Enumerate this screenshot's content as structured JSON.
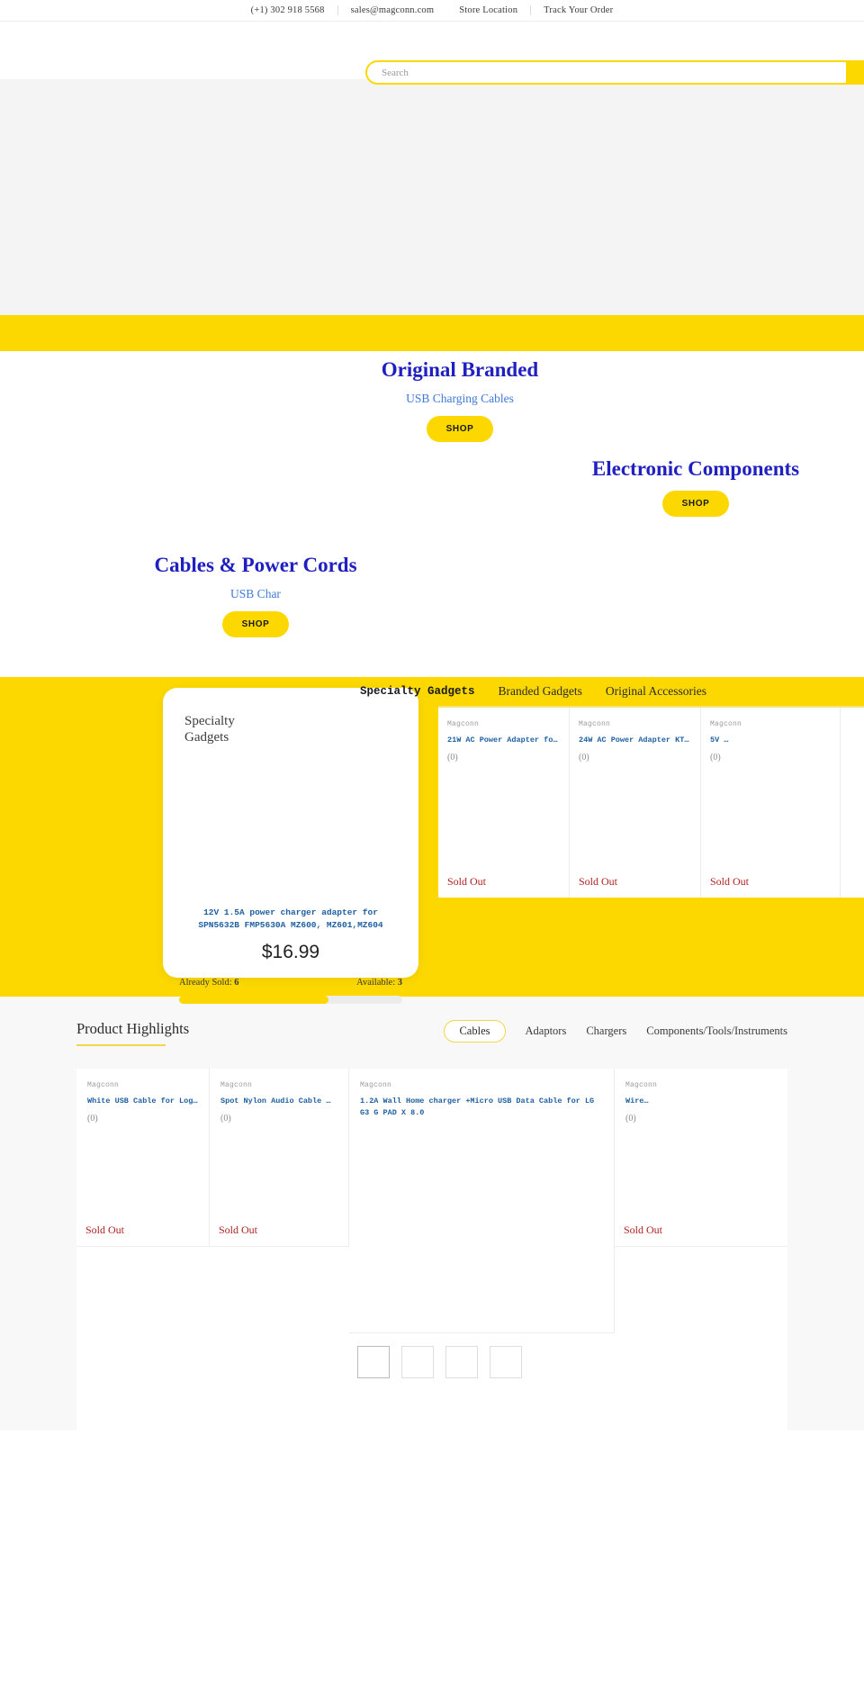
{
  "topbar": {
    "phone": "(+1) 302 918 5568",
    "email": "sales@magconn.com",
    "store_location": "Store Location",
    "track_order": "Track Your Order"
  },
  "search": {
    "placeholder": "Search",
    "value": "",
    "icon": "search-icon"
  },
  "theme": {
    "yellow": "#fcd800",
    "blue": "#2020c0",
    "link_blue": "#1d5fa0",
    "sub_blue": "#3f79d8",
    "soldout_red": "#b02020"
  },
  "promos": [
    {
      "title": "Original Branded",
      "subtitle": "USB Charging Cables",
      "cta": "SHOP"
    },
    {
      "title": "Electronic Components",
      "subtitle": "",
      "cta": "SHOP"
    },
    {
      "title": "Cables & Power Cords",
      "subtitle": "USB Char",
      "cta": "SHOP"
    }
  ],
  "carousel": {
    "tabs": [
      {
        "label": "Specialty Gadgets",
        "active": true
      },
      {
        "label": "Branded Gadgets",
        "active": false
      },
      {
        "label": "Original Accessories",
        "active": false
      }
    ],
    "feature": {
      "kicker_line1": "Specialty",
      "kicker_line2": "Gadgets",
      "title": "12V 1.5A power charger adapter for SPN5632B FMP5630A MZ600, MZ601,MZ604",
      "price": "$16.99",
      "already_sold_label": "Already Sold:",
      "already_sold_value": "6",
      "available_label": "Available:",
      "available_value": "3",
      "progress_percent": 67
    },
    "products": [
      {
        "brand": "Magconn",
        "title": "21W AC Power Adapter fo…",
        "rating": "(0)",
        "status": "Sold Out"
      },
      {
        "brand": "Magconn",
        "title": "24W AC Power Adapter KT…",
        "rating": "(0)",
        "status": "Sold Out"
      },
      {
        "brand": "Magconn",
        "title": "5V …",
        "rating": "(0)",
        "status": "Sold Out"
      }
    ]
  },
  "highlights": {
    "title": "Product Highlights",
    "tabs": [
      {
        "label": "Cables",
        "active": true
      },
      {
        "label": "Adaptors",
        "active": false
      },
      {
        "label": "Chargers",
        "active": false
      },
      {
        "label": "Components/Tools/Instruments",
        "active": false
      }
    ],
    "products": [
      {
        "brand": "Magconn",
        "title": "White USB Cable for Log…",
        "rating": "(0)",
        "status": "Sold Out"
      },
      {
        "brand": "Magconn",
        "title": "Spot Nylon Audio Cable …",
        "rating": "(0)",
        "status": "Sold Out"
      },
      {
        "brand": "Magconn",
        "title": "1.2A Wall Home charger +Micro USB Data Cable for LG G3 G PAD X 8.0",
        "rating": "",
        "status": ""
      },
      {
        "brand": "Magconn",
        "title": "Wire…",
        "rating": "(0)",
        "status": "Sold Out"
      }
    ],
    "thumbnail_count": 4
  }
}
